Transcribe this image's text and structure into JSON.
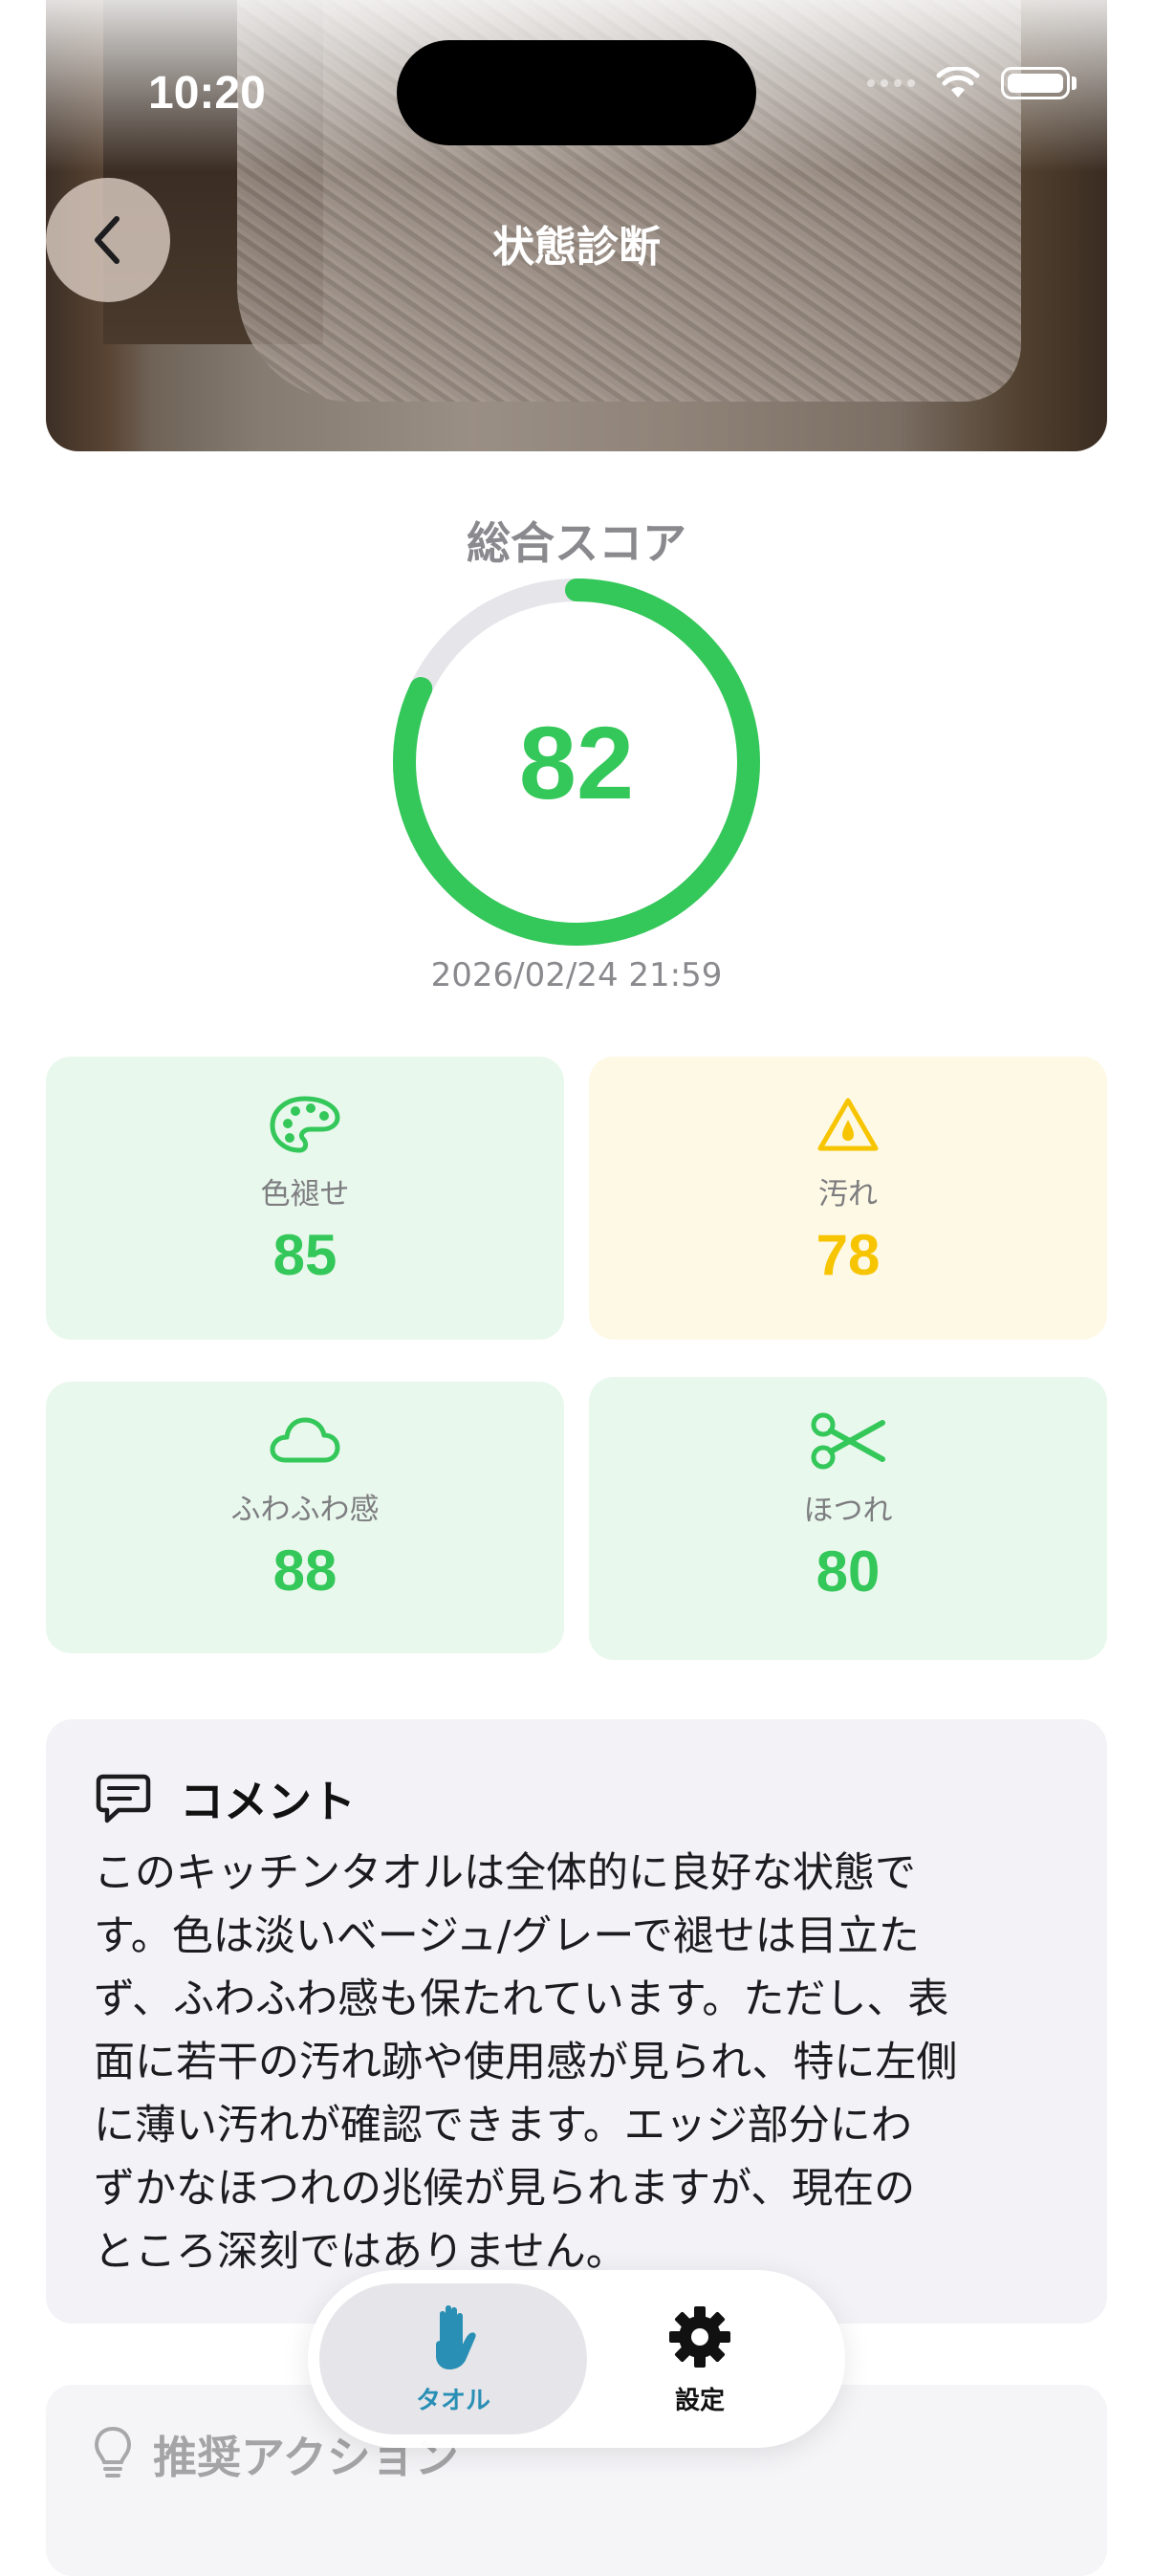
{
  "status_bar": {
    "time": "10:20"
  },
  "header": {
    "title": "状態診断",
    "back_icon": "chevron-left-icon"
  },
  "overall": {
    "label": "総合スコア",
    "score": 82,
    "max": 100,
    "timestamp": "2026/02/24 21:59",
    "color": "#34c759"
  },
  "metrics": [
    {
      "icon": "palette-icon",
      "label": "色褪せ",
      "value": "85",
      "status": "good",
      "color": "#34c759"
    },
    {
      "icon": "drop-warning-icon",
      "label": "汚れ",
      "value": "78",
      "status": "warning",
      "color": "#f7c400"
    },
    {
      "icon": "cloud-icon",
      "label": "ふわふわ感",
      "value": "88",
      "status": "good",
      "color": "#34c759"
    },
    {
      "icon": "scissors-icon",
      "label": "ほつれ",
      "value": "80",
      "status": "good",
      "color": "#34c759"
    }
  ],
  "comment": {
    "title": "コメント",
    "icon": "comment-icon",
    "lines": [
      "このキッチンタオルは全体的に良好な状態で",
      "す。色は淡いベージュ/グレーで褪せは目立た",
      "ず、ふわふわ感も保たれています。ただし、表",
      "面に若干の汚れ跡や使用感が見られ、特に左側",
      "に薄い汚れが確認できます。エッジ部分にわ",
      "ずかなほつれの兆候が見られますが、現在の",
      "ところ深刻ではありません。"
    ]
  },
  "actions": {
    "title": "推奨アクション",
    "icon": "lightbulb-icon"
  },
  "tabbar": {
    "items": [
      {
        "label": "タオル",
        "icon": "hand-icon",
        "active": true
      },
      {
        "label": "設定",
        "icon": "gear-icon",
        "active": false
      }
    ]
  }
}
